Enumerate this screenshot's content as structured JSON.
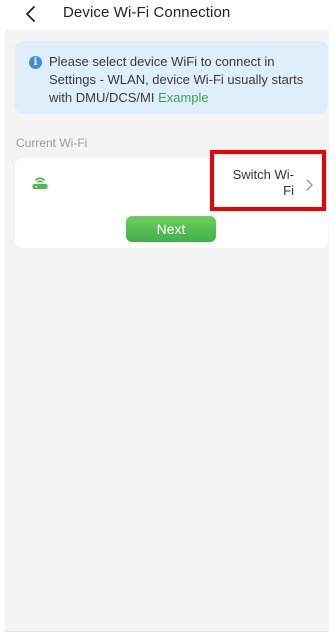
{
  "header": {
    "title": "Device Wi-Fi Connection",
    "back_icon": "chevron-left-icon"
  },
  "info": {
    "icon": "info-icon",
    "text": "Please select device WiFi to connect in Settings - WLAN, device Wi-Fi usually starts with DMU/DCS/MI",
    "link_label": "Example",
    "link_color": "#3aa64a",
    "background": "#dfeefb"
  },
  "current_wifi": {
    "section_label": "Current Wi-Fi",
    "router_icon": "router-icon",
    "switch_label": "Switch Wi-Fi",
    "switch_icon": "chevron-right-icon"
  },
  "actions": {
    "next_label": "Next",
    "next_color": "#4cbb4f"
  },
  "annotation": {
    "highlight_color": "#ee0000"
  }
}
